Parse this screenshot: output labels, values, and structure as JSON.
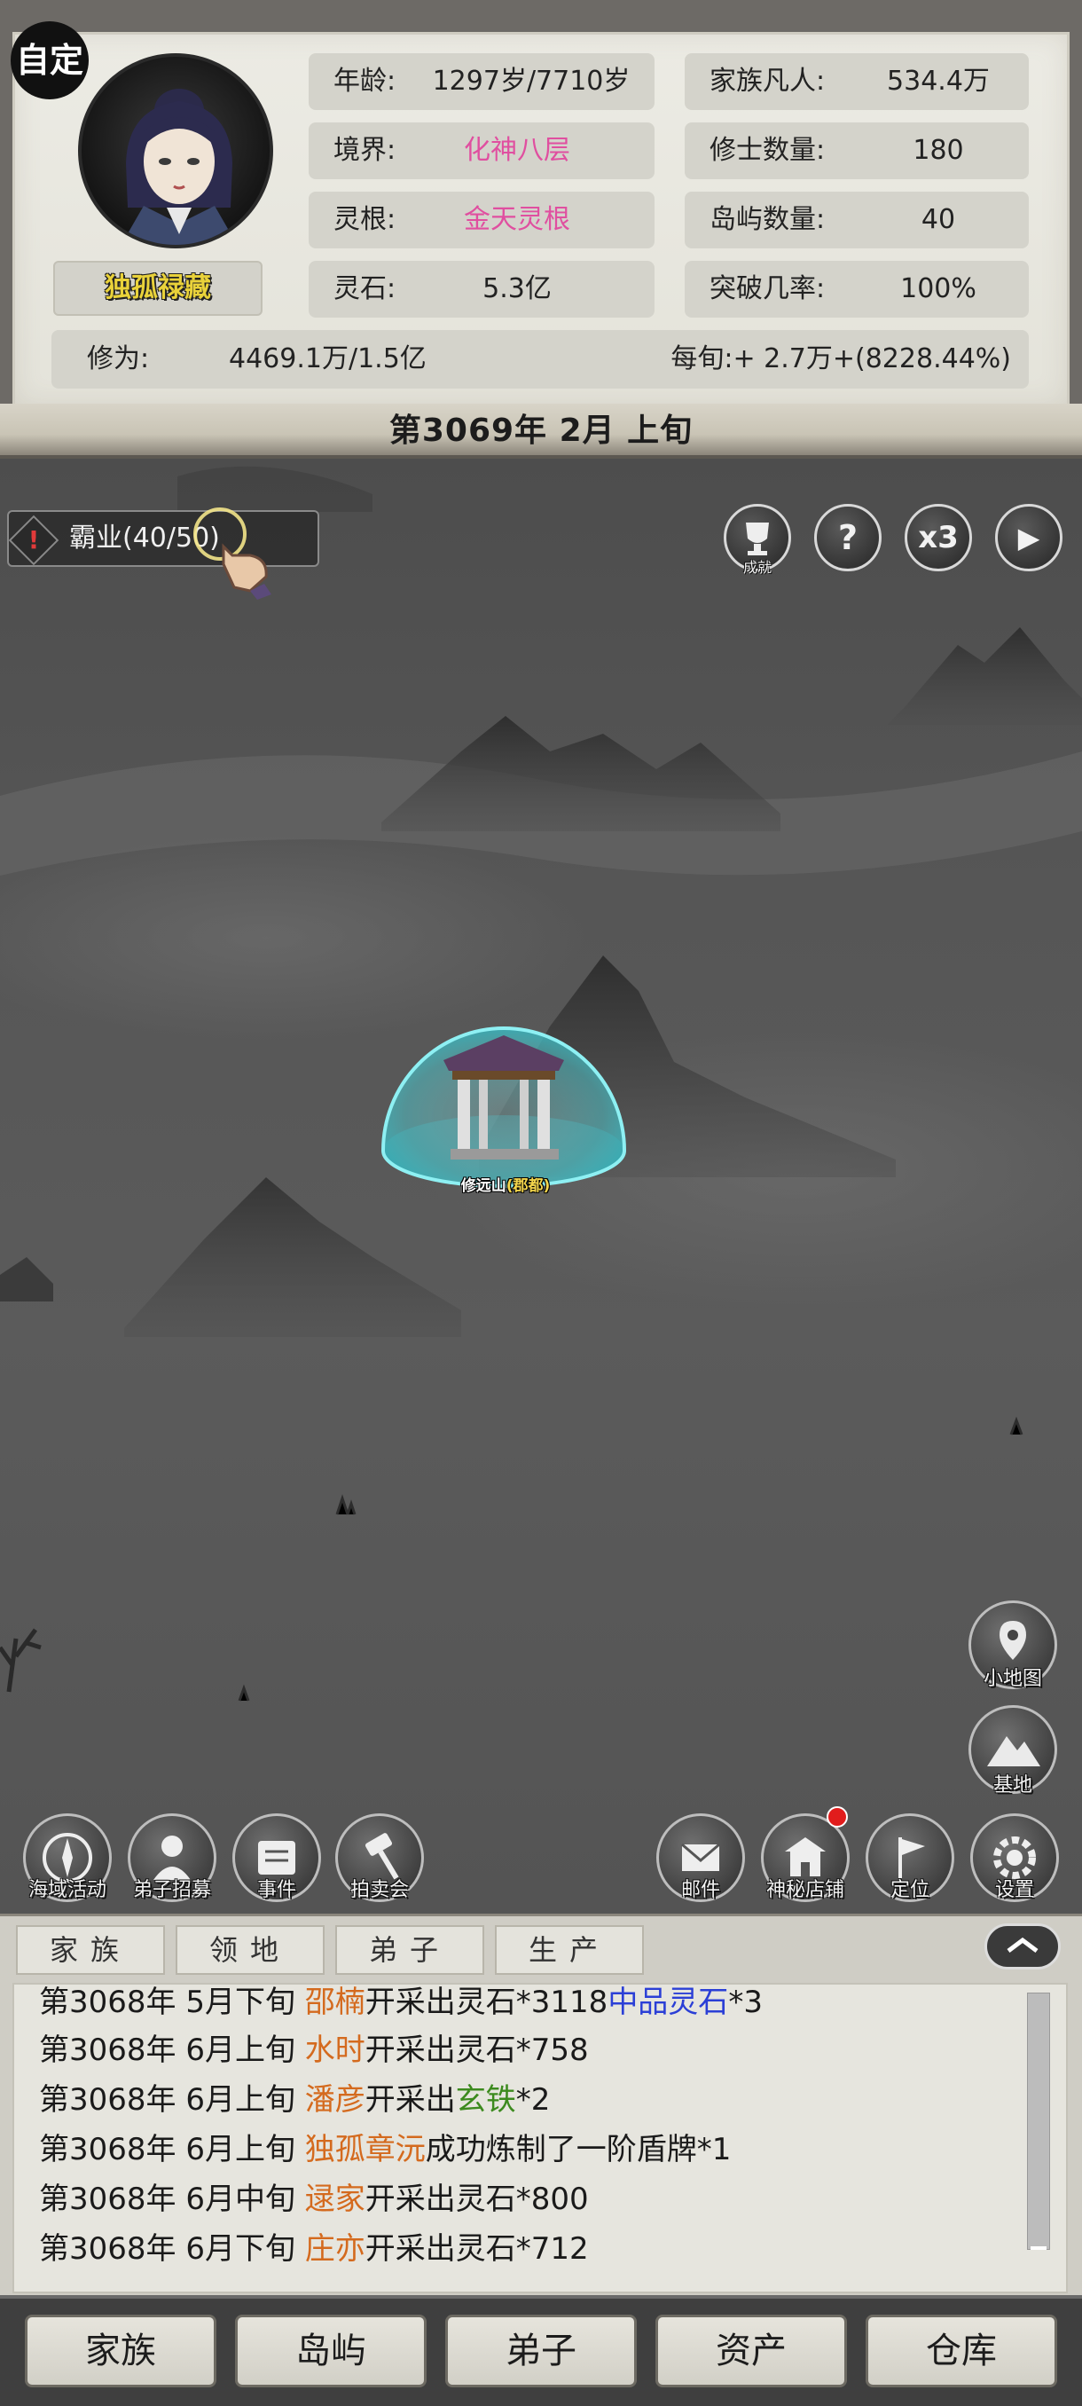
{
  "header": {
    "custom_badge": "自定",
    "player_name": "独孤禄藏",
    "date": "第3069年 2月 上旬",
    "stats": {
      "age_label": "年龄:",
      "age_value": "1297岁/7710岁",
      "realm_label": "境界:",
      "realm_value": "化神八层",
      "root_label": "灵根:",
      "root_value": "金天灵根",
      "stone_label": "灵石:",
      "stone_value": "5.3亿",
      "family_label": "家族凡人:",
      "family_value": "534.4万",
      "cultivator_label": "修士数量:",
      "cultivator_value": "180",
      "island_label": "岛屿数量:",
      "island_value": "40",
      "breakthrough_label": "突破几率:",
      "breakthrough_value": "100%"
    },
    "cultivation": {
      "label": "修为:",
      "value": "4469.1万/1.5亿",
      "rate": "每旬:+ 2.7万+(8228.44%)"
    },
    "realm_color": "#e04fa0"
  },
  "map": {
    "quest_tracker": "霸业(40/50)",
    "top_buttons": {
      "achievement_label": "成就",
      "help_symbol": "?",
      "speed_label": "x3",
      "play_symbol": "▶"
    },
    "right_buttons": {
      "minimap_label": "小地图",
      "base_label": "基地"
    },
    "base_name": "修远山",
    "base_capital": "(郡都)",
    "left_actions": [
      "海域活动",
      "弟子招募",
      "事件",
      "拍卖会"
    ],
    "right_actions": [
      "邮件",
      "神秘店铺",
      "定位",
      "设置"
    ]
  },
  "log": {
    "tabs": [
      "家族",
      "领地",
      "弟子",
      "生产"
    ],
    "rows": [
      {
        "prefix": "第3068年 5月下旬 ",
        "name": "邵楠",
        "mid": "开采出灵石*3118",
        "item": "中品灵石",
        "suffix": "*3"
      },
      {
        "prefix": "第3068年 6月上旬 ",
        "name": "水时",
        "mid": "开采出灵石*758",
        "item": "",
        "suffix": ""
      },
      {
        "prefix": "第3068年 6月上旬 ",
        "name": "潘彦",
        "mid": "开采出",
        "item": "玄铁",
        "suffix": "*2"
      },
      {
        "prefix": "第3068年 6月上旬 ",
        "name": "独孤章沅",
        "mid": "成功炼制了一阶盾牌*1",
        "item": "",
        "suffix": ""
      },
      {
        "prefix": "第3068年 6月中旬 ",
        "name": "逯家",
        "mid": "开采出灵石*800",
        "item": "",
        "suffix": ""
      },
      {
        "prefix": "第3068年 6月下旬 ",
        "name": "庄亦",
        "mid": "开采出灵石*712",
        "item": "",
        "suffix": ""
      }
    ]
  },
  "bottom_nav": [
    "家族",
    "岛屿",
    "弟子",
    "资产",
    "仓库"
  ]
}
